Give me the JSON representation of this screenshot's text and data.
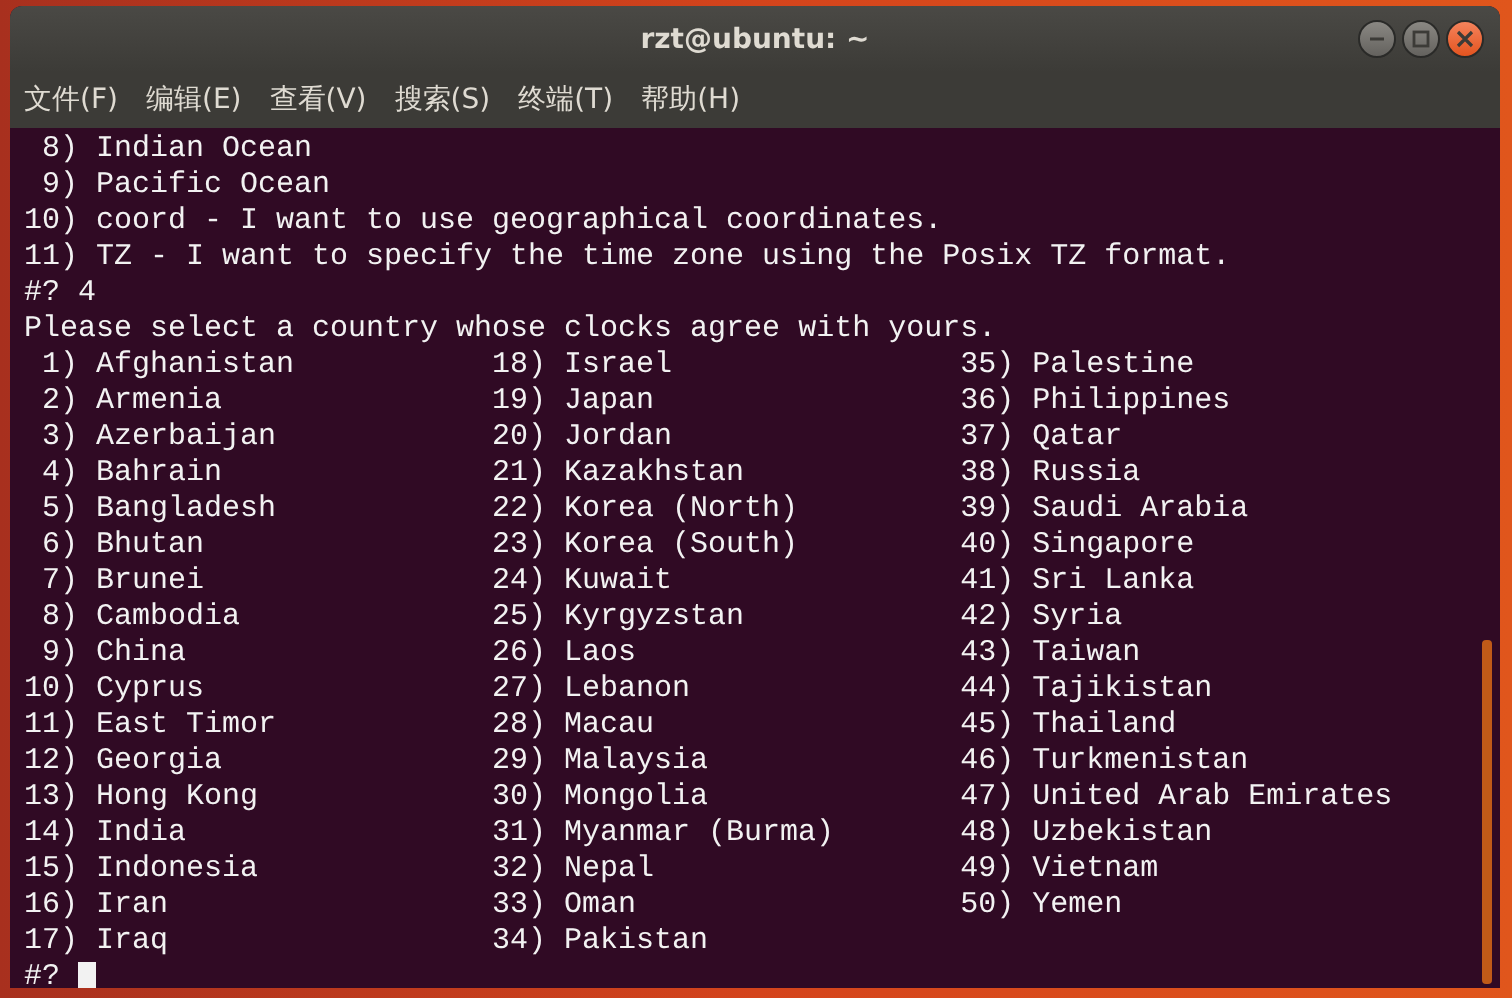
{
  "window": {
    "title": "rzt@ubuntu: ~"
  },
  "menu": [
    "文件(F)",
    "编辑(E)",
    "查看(V)",
    "搜索(S)",
    "终端(T)",
    "帮助(H)"
  ],
  "terminal": {
    "lines": [
      " 8) Indian Ocean",
      " 9) Pacific Ocean",
      "10) coord - I want to use geographical coordinates.",
      "11) TZ - I want to specify the time zone using the Posix TZ format.",
      "#? 4",
      "Please select a country whose clocks agree with yours."
    ],
    "countries": [
      {
        "num": "1)",
        "name": "Afghanistan"
      },
      {
        "num": "2)",
        "name": "Armenia"
      },
      {
        "num": "3)",
        "name": "Azerbaijan"
      },
      {
        "num": "4)",
        "name": "Bahrain"
      },
      {
        "num": "5)",
        "name": "Bangladesh"
      },
      {
        "num": "6)",
        "name": "Bhutan"
      },
      {
        "num": "7)",
        "name": "Brunei"
      },
      {
        "num": "8)",
        "name": "Cambodia"
      },
      {
        "num": "9)",
        "name": "China"
      },
      {
        "num": "10)",
        "name": "Cyprus"
      },
      {
        "num": "11)",
        "name": "East Timor"
      },
      {
        "num": "12)",
        "name": "Georgia"
      },
      {
        "num": "13)",
        "name": "Hong Kong"
      },
      {
        "num": "14)",
        "name": "India"
      },
      {
        "num": "15)",
        "name": "Indonesia"
      },
      {
        "num": "16)",
        "name": "Iran"
      },
      {
        "num": "17)",
        "name": "Iraq"
      },
      {
        "num": "18)",
        "name": "Israel"
      },
      {
        "num": "19)",
        "name": "Japan"
      },
      {
        "num": "20)",
        "name": "Jordan"
      },
      {
        "num": "21)",
        "name": "Kazakhstan"
      },
      {
        "num": "22)",
        "name": "Korea (North)"
      },
      {
        "num": "23)",
        "name": "Korea (South)"
      },
      {
        "num": "24)",
        "name": "Kuwait"
      },
      {
        "num": "25)",
        "name": "Kyrgyzstan"
      },
      {
        "num": "26)",
        "name": "Laos"
      },
      {
        "num": "27)",
        "name": "Lebanon"
      },
      {
        "num": "28)",
        "name": "Macau"
      },
      {
        "num": "29)",
        "name": "Malaysia"
      },
      {
        "num": "30)",
        "name": "Mongolia"
      },
      {
        "num": "31)",
        "name": "Myanmar (Burma)"
      },
      {
        "num": "32)",
        "name": "Nepal"
      },
      {
        "num": "33)",
        "name": "Oman"
      },
      {
        "num": "34)",
        "name": "Pakistan"
      },
      {
        "num": "35)",
        "name": "Palestine"
      },
      {
        "num": "36)",
        "name": "Philippines"
      },
      {
        "num": "37)",
        "name": "Qatar"
      },
      {
        "num": "38)",
        "name": "Russia"
      },
      {
        "num": "39)",
        "name": "Saudi Arabia"
      },
      {
        "num": "40)",
        "name": "Singapore"
      },
      {
        "num": "41)",
        "name": "Sri Lanka"
      },
      {
        "num": "42)",
        "name": "Syria"
      },
      {
        "num": "43)",
        "name": "Taiwan"
      },
      {
        "num": "44)",
        "name": "Tajikistan"
      },
      {
        "num": "45)",
        "name": "Thailand"
      },
      {
        "num": "46)",
        "name": "Turkmenistan"
      },
      {
        "num": "47)",
        "name": "United Arab Emirates"
      },
      {
        "num": "48)",
        "name": "Uzbekistan"
      },
      {
        "num": "49)",
        "name": "Vietnam"
      },
      {
        "num": "50)",
        "name": "Yemen"
      }
    ],
    "prompt": "#?"
  }
}
